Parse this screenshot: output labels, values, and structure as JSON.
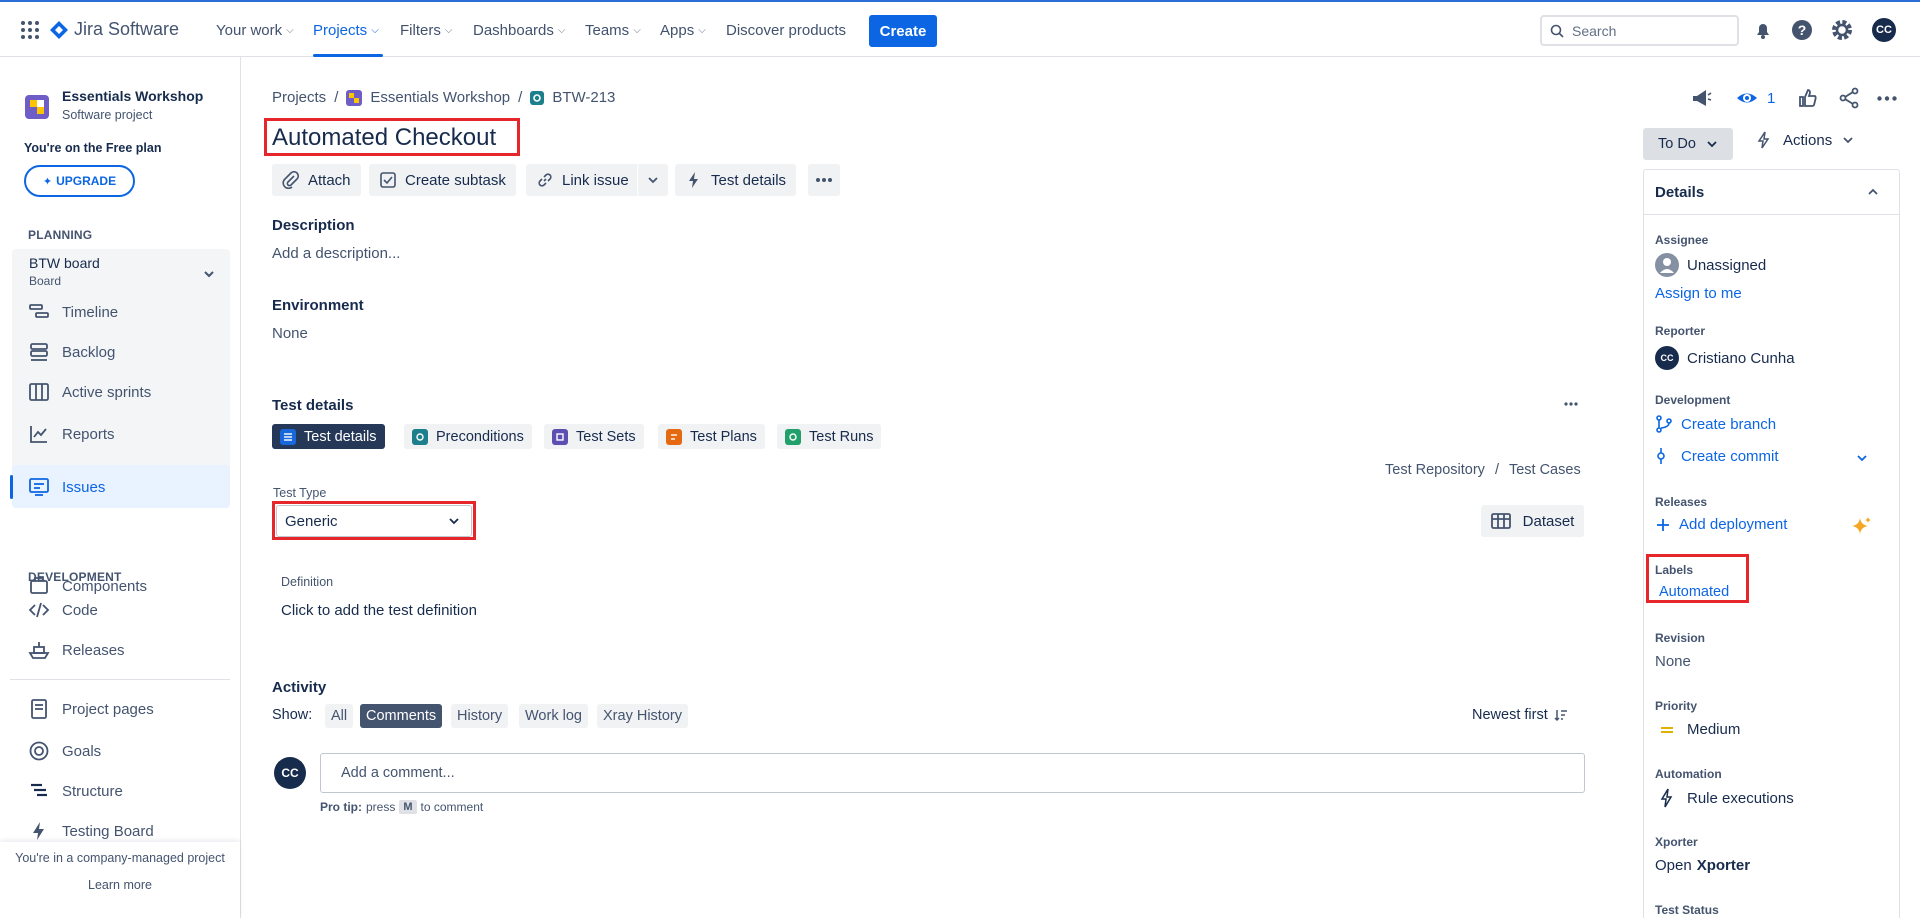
{
  "topnav": {
    "app_name": "Jira Software",
    "items": [
      "Your work",
      "Projects",
      "Filters",
      "Dashboards",
      "Teams",
      "Apps"
    ],
    "discover": "Discover products",
    "create": "Create",
    "search_placeholder": "Search",
    "user_initials": "CC"
  },
  "sidebar": {
    "project_name": "Essentials Workshop",
    "project_type": "Software project",
    "plan_text": "You're on the Free plan",
    "upgrade": "UPGRADE",
    "planning_label": "PLANNING",
    "board_name": "BTW board",
    "board_type": "Board",
    "planning_items": [
      "Timeline",
      "Backlog",
      "Active sprints",
      "Reports"
    ],
    "issues": "Issues",
    "components": "Components",
    "development_label": "DEVELOPMENT",
    "dev_items": [
      "Code",
      "Releases"
    ],
    "other_items": [
      "Project pages",
      "Goals",
      "Structure",
      "Testing Board"
    ],
    "footer_text": "You're in a company-managed project",
    "learn_more": "Learn more"
  },
  "breadcrumb": {
    "projects": "Projects",
    "project": "Essentials Workshop",
    "issue_key": "BTW-213"
  },
  "issue": {
    "title": "Automated Checkout",
    "toolbar": {
      "attach": "Attach",
      "create_subtask": "Create subtask",
      "link_issue": "Link issue",
      "test_details": "Test details"
    },
    "description_label": "Description",
    "description_placeholder": "Add a description...",
    "environment_label": "Environment",
    "environment_value": "None",
    "test_details_label": "Test details",
    "tabs": [
      "Test details",
      "Preconditions",
      "Test Sets",
      "Test Plans",
      "Test Runs"
    ],
    "repo_path": [
      "Test Repository",
      "Test Cases"
    ],
    "test_type_label": "Test Type",
    "test_type_value": "Generic",
    "dataset": "Dataset",
    "definition_label": "Definition",
    "definition_placeholder": "Click to add the test definition"
  },
  "activity": {
    "label": "Activity",
    "show": "Show:",
    "filters": [
      "All",
      "Comments",
      "History",
      "Work log",
      "Xray History"
    ],
    "active_filter": "Comments",
    "sort": "Newest first",
    "comment_placeholder": "Add a comment...",
    "pro_tip_prefix": "Pro tip:",
    "pro_tip_press": "press",
    "pro_tip_key": "M",
    "pro_tip_suffix": "to comment"
  },
  "right_panel": {
    "watch_count": "1",
    "status": "To Do",
    "actions": "Actions",
    "details_title": "Details",
    "assignee_label": "Assignee",
    "assignee_value": "Unassigned",
    "assign_to_me": "Assign to me",
    "reporter_label": "Reporter",
    "reporter_value": "Cristiano Cunha",
    "reporter_initials": "CC",
    "development_label": "Development",
    "create_branch": "Create branch",
    "create_commit": "Create commit",
    "releases_label": "Releases",
    "add_deployment": "Add deployment",
    "labels_label": "Labels",
    "labels_value": "Automated",
    "revision_label": "Revision",
    "revision_value": "None",
    "priority_label": "Priority",
    "priority_value": "Medium",
    "automation_label": "Automation",
    "automation_value": "Rule executions",
    "xporter_label": "Xporter",
    "xporter_open": "Open",
    "xporter_name": "Xporter",
    "test_status_label": "Test Status"
  },
  "colors": {
    "accent": "#0c66e4",
    "highlight": "#e5262b",
    "selected_tab": "#253858"
  }
}
